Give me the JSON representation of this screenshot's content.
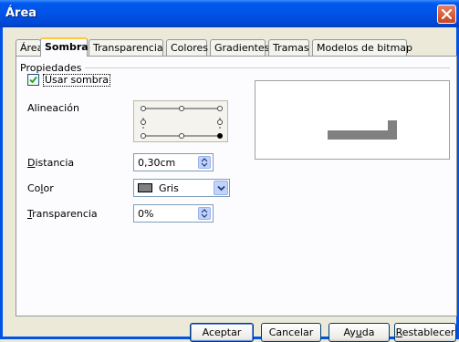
{
  "window": {
    "title": "Área"
  },
  "tabs": [
    {
      "label": "Área"
    },
    {
      "label": "Sombra"
    },
    {
      "label": "Transparencia"
    },
    {
      "label": "Colores"
    },
    {
      "label": "Gradientes"
    },
    {
      "label": "Tramas"
    },
    {
      "label": "Modelos de bitmap"
    }
  ],
  "active_tab": "Sombra",
  "properties": {
    "group_label": "Propiedades",
    "use_shadow_label": "Usar sombra",
    "use_shadow_checked": true,
    "alignment_label": "Alineación",
    "alignment_selected": "bottom-right",
    "distance_label": "Distancia",
    "distance_value": "0,30cm",
    "color_label": "Color",
    "color_value": "Gris",
    "color_hex": "#808080",
    "transparency_label": "Transparencia",
    "transparency_value": "0%"
  },
  "buttons": {
    "ok": "Aceptar",
    "cancel": "Cancelar",
    "help": "Ayuda",
    "reset": "Restablecer"
  },
  "icons": {
    "close": "close-icon",
    "spin": "spin-arrows-icon",
    "dropdown": "chevron-down-icon",
    "check": "check-icon"
  }
}
